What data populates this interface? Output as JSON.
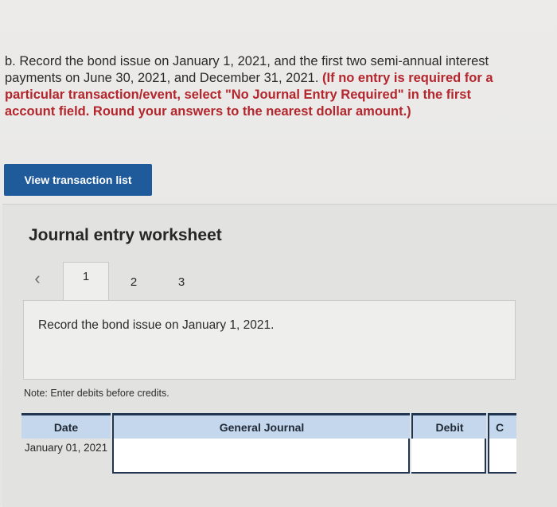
{
  "instructions": {
    "lead": "b. Record the bond issue on January 1, 2021, and the first two semi-annual interest payments on June 30, 2021, and December 31, 2021. ",
    "emphasis": "(If no entry is required for a particular transaction/event, select \"No Journal Entry Required\" in the first account field. Round your answers to the nearest dollar amount.)"
  },
  "buttons": {
    "view_transaction_list": "View transaction list"
  },
  "worksheet": {
    "title": "Journal entry worksheet",
    "tabs": [
      "1",
      "2",
      "3"
    ],
    "active_tab": "1",
    "entry_prompt": "Record the bond issue on January 1, 2021.",
    "note": "Note: Enter debits before credits."
  },
  "table": {
    "headers": {
      "date": "Date",
      "general_journal": "General Journal",
      "debit": "Debit",
      "credit": "C"
    },
    "rows": [
      {
        "date": "January 01, 2021",
        "account": "",
        "debit": "",
        "credit": ""
      }
    ]
  },
  "colors": {
    "button_bg": "#1f5a9b",
    "emphasis_red": "#b3262d",
    "header_bg": "#c5d7ec",
    "border_navy": "#1f3552"
  }
}
